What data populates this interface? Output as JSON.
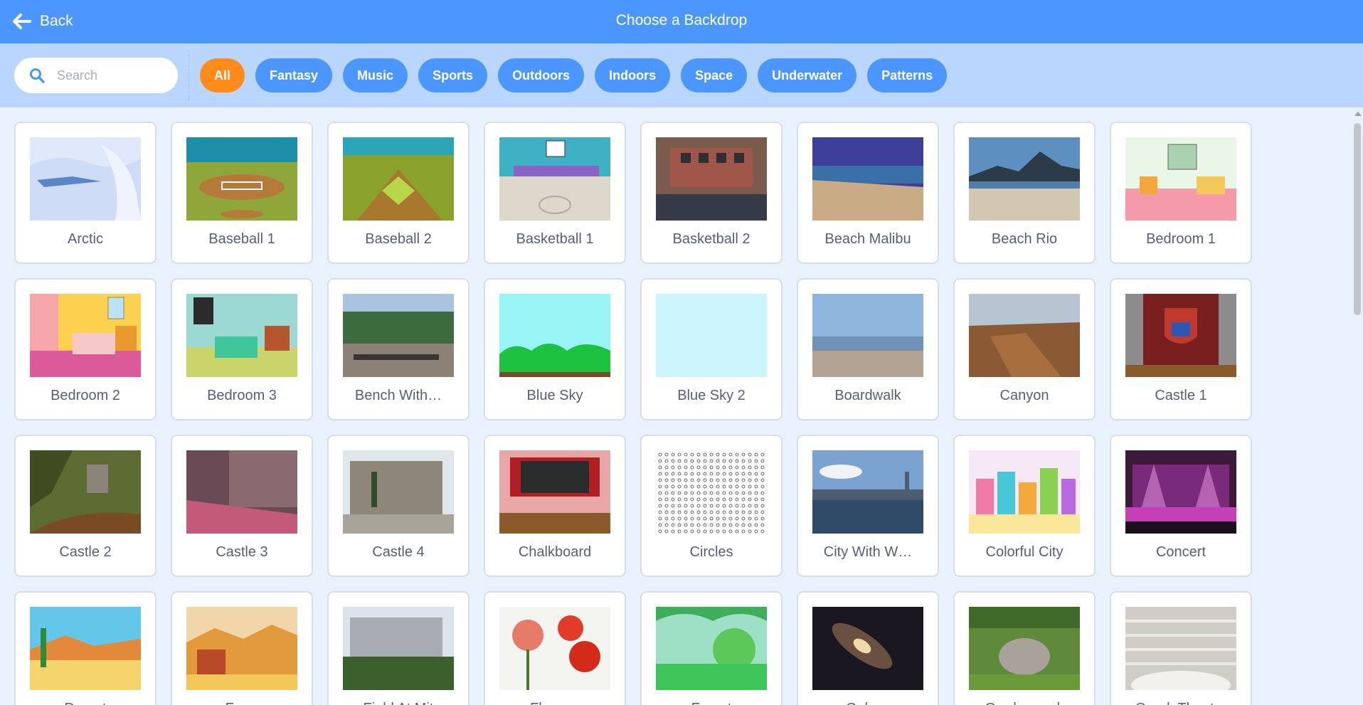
{
  "header": {
    "back_label": "Back",
    "title": "Choose a Backdrop",
    "back_icon": "arrow-left-icon"
  },
  "search": {
    "placeholder": "Search",
    "value": "",
    "icon": "search-icon"
  },
  "tags": [
    {
      "label": "All",
      "active": true
    },
    {
      "label": "Fantasy"
    },
    {
      "label": "Music"
    },
    {
      "label": "Sports"
    },
    {
      "label": "Outdoors"
    },
    {
      "label": "Indoors"
    },
    {
      "label": "Space"
    },
    {
      "label": "Underwater"
    },
    {
      "label": "Patterns"
    }
  ],
  "backdrops": [
    {
      "name": "Arctic"
    },
    {
      "name": "Baseball 1"
    },
    {
      "name": "Baseball 2"
    },
    {
      "name": "Basketball 1"
    },
    {
      "name": "Basketball 2"
    },
    {
      "name": "Beach Malibu"
    },
    {
      "name": "Beach Rio"
    },
    {
      "name": "Bedroom 1"
    },
    {
      "name": "Bedroom 2"
    },
    {
      "name": "Bedroom 3"
    },
    {
      "name": "Bench With…"
    },
    {
      "name": "Blue Sky"
    },
    {
      "name": "Blue Sky 2"
    },
    {
      "name": "Boardwalk"
    },
    {
      "name": "Canyon"
    },
    {
      "name": "Castle 1"
    },
    {
      "name": "Castle 2"
    },
    {
      "name": "Castle 3"
    },
    {
      "name": "Castle 4"
    },
    {
      "name": "Chalkboard"
    },
    {
      "name": "Circles"
    },
    {
      "name": "City With W…"
    },
    {
      "name": "Colorful City"
    },
    {
      "name": "Concert"
    },
    {
      "name": "Desert"
    },
    {
      "name": "Farm"
    },
    {
      "name": "Field At Mit"
    },
    {
      "name": "Flowers"
    },
    {
      "name": "Forest"
    },
    {
      "name": "Galaxy"
    },
    {
      "name": "Garden-rock"
    },
    {
      "name": "Greek Theater"
    }
  ],
  "colors": {
    "header": "#4c97ff",
    "filterbar": "#b9d6ff",
    "active_tag": "#ff8c1a",
    "tag": "#4c97ff",
    "background": "#e9f1fc",
    "text": "#575e75"
  }
}
